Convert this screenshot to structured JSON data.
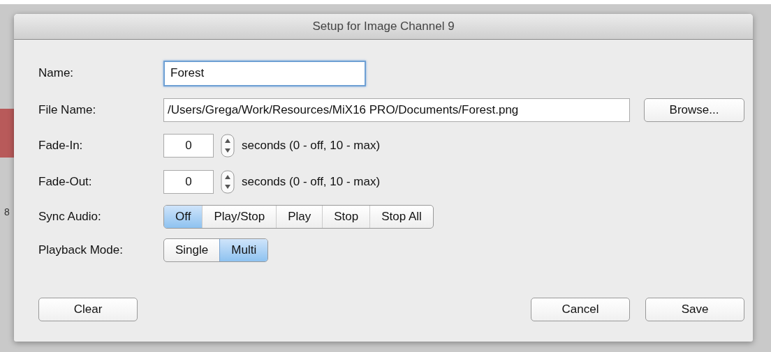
{
  "background": {
    "text": "8"
  },
  "window": {
    "title": "Setup for Image Channel 9"
  },
  "name": {
    "label": "Name:",
    "value": "Forest"
  },
  "file_name": {
    "label": "File Name:",
    "value": "/Users/Grega/Work/Resources/MiX16 PRO/Documents/Forest.png",
    "button": "Browse..."
  },
  "fades": [
    {
      "label": "Fade-In:",
      "value": "0",
      "hint": "seconds (0 - off, 10 - max)"
    },
    {
      "label": "Fade-Out:",
      "value": "0",
      "hint": "seconds (0 - off, 10 - max)"
    }
  ],
  "segments": [
    {
      "label": "Sync Audio:",
      "options": [
        {
          "label": "Off",
          "selected": true
        },
        {
          "label": "Play/Stop",
          "selected": false
        },
        {
          "label": "Play",
          "selected": false
        },
        {
          "label": "Stop",
          "selected": false
        },
        {
          "label": "Stop All",
          "selected": false
        }
      ]
    },
    {
      "label": "Playback Mode:",
      "options": [
        {
          "label": "Single",
          "selected": false
        },
        {
          "label": "Multi",
          "selected": true
        }
      ]
    }
  ],
  "buttons": {
    "left": "Clear",
    "right": [
      "Cancel",
      "Save"
    ]
  }
}
